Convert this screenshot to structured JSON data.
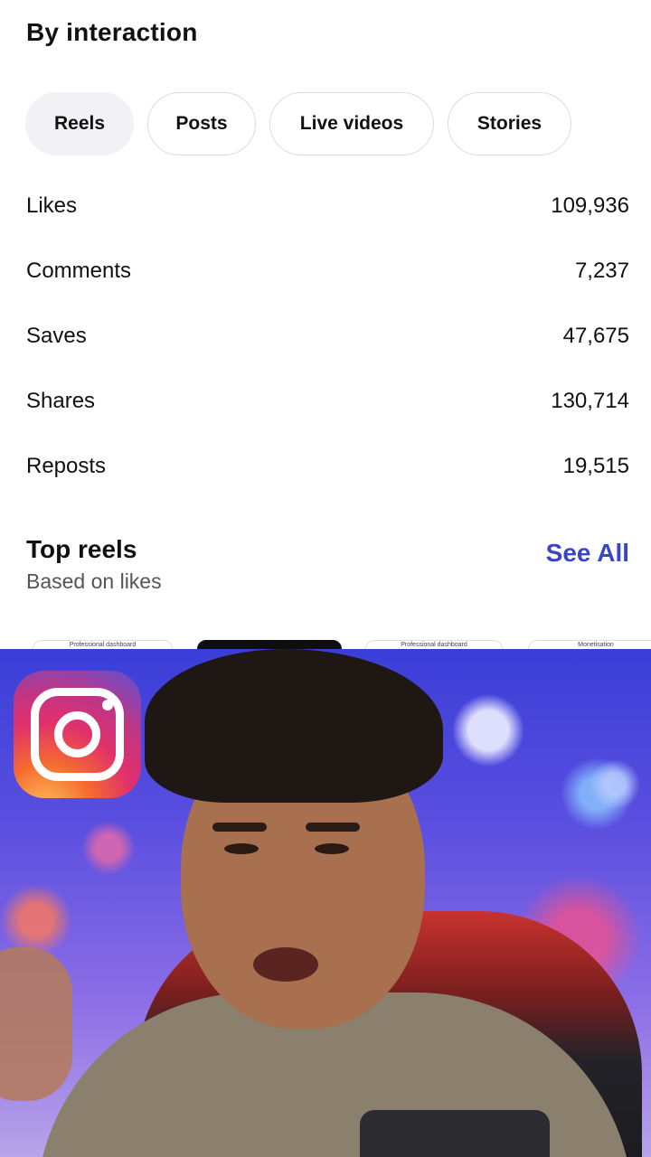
{
  "section": {
    "title": "By interaction"
  },
  "tabs": [
    {
      "label": "Reels",
      "active": true
    },
    {
      "label": "Posts",
      "active": false
    },
    {
      "label": "Live videos",
      "active": false
    },
    {
      "label": "Stories",
      "active": false
    }
  ],
  "metrics": [
    {
      "label": "Likes",
      "value": "109,936"
    },
    {
      "label": "Comments",
      "value": "7,237"
    },
    {
      "label": "Saves",
      "value": "47,675"
    },
    {
      "label": "Shares",
      "value": "130,714"
    },
    {
      "label": "Reposts",
      "value": "19,515"
    }
  ],
  "top_reels": {
    "title": "Top reels",
    "subtitle": "Based on likes",
    "see_all": "See All",
    "thumbnails": [
      {
        "caption": "Professional dashboard"
      },
      {
        "caption": ""
      },
      {
        "caption": "Professional dashboard"
      },
      {
        "caption": "Monetisation"
      }
    ]
  },
  "overlay": {
    "logo": "instagram-logo-icon"
  },
  "colors": {
    "accent": "#3a45c4",
    "active_tab_bg": "#f1f1f6"
  }
}
